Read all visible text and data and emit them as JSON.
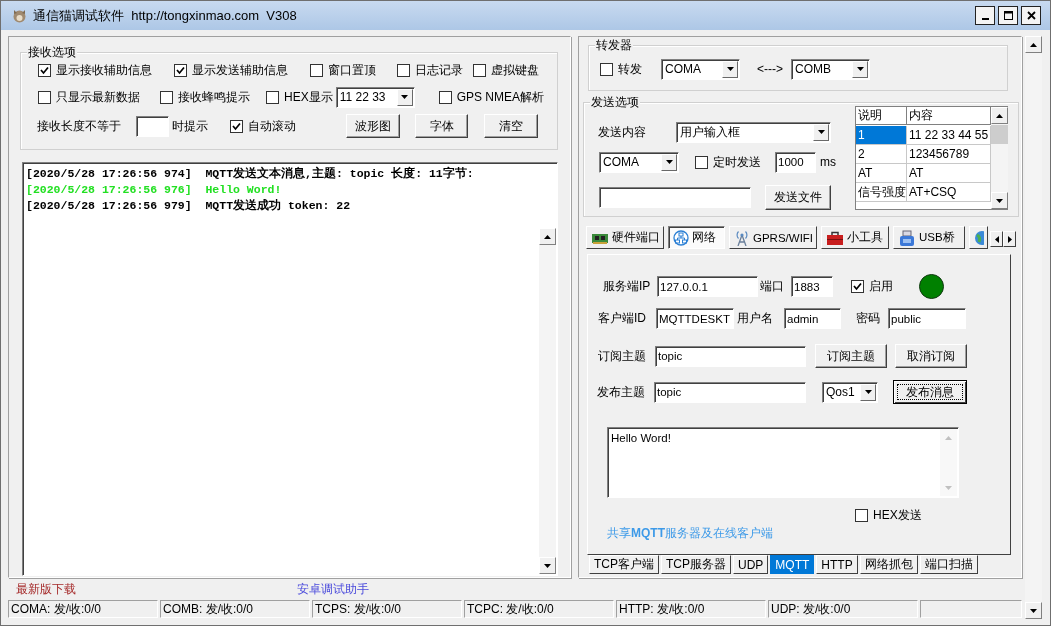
{
  "window": {
    "title": "通信猫调试软件  http://tongxinmao.com  V308"
  },
  "receive_options": {
    "title": "接收选项",
    "rows": [
      {
        "items": [
          {
            "kind": "checkbox",
            "label": "显示接收辅助信息",
            "checked": true
          },
          {
            "kind": "checkbox",
            "label": "显示发送辅助信息",
            "checked": true
          },
          {
            "kind": "checkbox",
            "label": "窗口置顶",
            "checked": false
          },
          {
            "kind": "checkbox",
            "label": "日志记录",
            "checked": false
          },
          {
            "kind": "checkbox",
            "label": "虚拟键盘",
            "checked": false
          }
        ]
      },
      {
        "items": [
          {
            "kind": "checkbox",
            "label": "只显示最新数据",
            "checked": false
          },
          {
            "kind": "checkbox",
            "label": "接收蜂鸣提示",
            "checked": false
          },
          {
            "kind": "checkbox",
            "label": "HEX显示",
            "checked": false
          },
          {
            "kind": "combo",
            "value": "11 22 33"
          },
          {
            "kind": "checkbox",
            "label": "GPS NMEA解析",
            "checked": false
          }
        ]
      },
      {
        "items": [
          {
            "kind": "label",
            "text": "接收长度不等于"
          },
          {
            "kind": "input"
          },
          {
            "kind": "label",
            "text": "时提示"
          },
          {
            "kind": "checkbox",
            "label": "自动滚动",
            "checked": true
          },
          {
            "kind": "button",
            "label": "波形图"
          },
          {
            "kind": "button",
            "label": "字体"
          },
          {
            "kind": "button",
            "label": "清空"
          }
        ]
      }
    ]
  },
  "log": {
    "lines": [
      {
        "text": "[2020/5/28 17:26:56 974]  MQTT发送文本消息,主题: topic 长度: 11字节:",
        "color": "#000000"
      },
      {
        "text": "[2020/5/28 17:26:56 976]  Hello Word!",
        "color": "#22e022"
      },
      {
        "text": "[2020/5/28 17:26:56 979]  MQTT发送成功 token: 22",
        "color": "#000000"
      }
    ]
  },
  "forwarder": {
    "title": "转发器",
    "items": [
      {
        "kind": "checkbox",
        "label": "转发",
        "checked": false
      },
      {
        "kind": "combo",
        "value": "COMA"
      },
      {
        "kind": "label",
        "text": "<--->"
      },
      {
        "kind": "combo",
        "value": "COMB"
      }
    ]
  },
  "send_options": {
    "title": "发送选项",
    "rows": [
      {
        "items": [
          {
            "kind": "label",
            "text": "发送内容"
          },
          {
            "kind": "combo",
            "value": "用户输入框"
          }
        ]
      },
      {
        "items": [
          {
            "kind": "combo",
            "value": "COMA"
          },
          {
            "kind": "checkbox",
            "label": "定时发送",
            "checked": false
          },
          {
            "kind": "input",
            "value": "1000"
          },
          {
            "kind": "label",
            "text": "ms"
          }
        ]
      },
      {
        "items": [
          {
            "kind": "input"
          },
          {
            "kind": "button",
            "label": "发送文件"
          }
        ]
      }
    ],
    "table": {
      "columns": [
        "说明",
        "内容"
      ],
      "rows": [
        {
          "cells": [
            "1",
            "11 22 33 44 55"
          ],
          "selected": true
        },
        {
          "cells": [
            "2",
            "123456789"
          ],
          "selected": false
        },
        {
          "cells": [
            "AT",
            "AT"
          ],
          "selected": false
        },
        {
          "cells": [
            "信号强度",
            "AT+CSQ"
          ],
          "selected": false
        }
      ]
    }
  },
  "tool_tabs": [
    {
      "label": "硬件端口",
      "selected": false
    },
    {
      "label": "网络",
      "selected": true
    },
    {
      "label": "GPRS/WIFI",
      "selected": false
    },
    {
      "label": "小工具",
      "selected": false
    },
    {
      "label": "USB桥",
      "selected": false
    }
  ],
  "mqtt": {
    "rows": [
      {
        "items": [
          {
            "kind": "label",
            "text": "服务端IP"
          },
          {
            "kind": "input",
            "value": "127.0.0.1"
          },
          {
            "kind": "label",
            "text": "端口"
          },
          {
            "kind": "input",
            "value": "1883"
          },
          {
            "kind": "checkbox",
            "label": "启用",
            "checked": true
          },
          {
            "kind": "status_light",
            "on": true
          }
        ]
      },
      {
        "items": [
          {
            "kind": "label",
            "text": "客户端ID"
          },
          {
            "kind": "input",
            "value": "MQTTDESKT"
          },
          {
            "kind": "label",
            "text": "用户名"
          },
          {
            "kind": "input",
            "value": "admin"
          },
          {
            "kind": "label",
            "text": "密码"
          },
          {
            "kind": "input",
            "value": "public"
          }
        ]
      },
      {
        "items": [
          {
            "kind": "label",
            "text": "订阅主题"
          },
          {
            "kind": "input",
            "value": "topic"
          },
          {
            "kind": "button",
            "label": "订阅主题",
            "focused": false
          },
          {
            "kind": "button",
            "label": "取消订阅",
            "focused": false
          }
        ]
      },
      {
        "items": [
          {
            "kind": "label",
            "text": "发布主题"
          },
          {
            "kind": "input",
            "value": "topic"
          },
          {
            "kind": "combo",
            "value": "Qos1"
          },
          {
            "kind": "button",
            "label": "发布消息",
            "focused": true
          }
        ]
      }
    ],
    "message": "Hello Word!",
    "hex_send": {
      "label": "HEX发送",
      "checked": false
    },
    "share_link": "共享**MQTT**服务器及在线客户端"
  },
  "protocol_tabs": [
    {
      "label": "TCP客户端",
      "selected": false
    },
    {
      "label": "TCP服务器",
      "selected": false
    },
    {
      "label": "UDP",
      "selected": false
    },
    {
      "label": "MQTT",
      "selected": true
    },
    {
      "label": "HTTP",
      "selected": false
    },
    {
      "label": "网络抓包",
      "selected": false
    },
    {
      "label": "端口扫描",
      "selected": false
    }
  ],
  "footer_links": [
    "最新版下载",
    "安卓调试助手"
  ],
  "status_bar": [
    "COMA: 发/收:0/0",
    "COMB: 发/收:0/0",
    "TCPS: 发/收:0/0",
    "TCPC: 发/收:0/0",
    "HTTP: 发/收:0/0",
    "UDP: 发/收:0/0"
  ]
}
